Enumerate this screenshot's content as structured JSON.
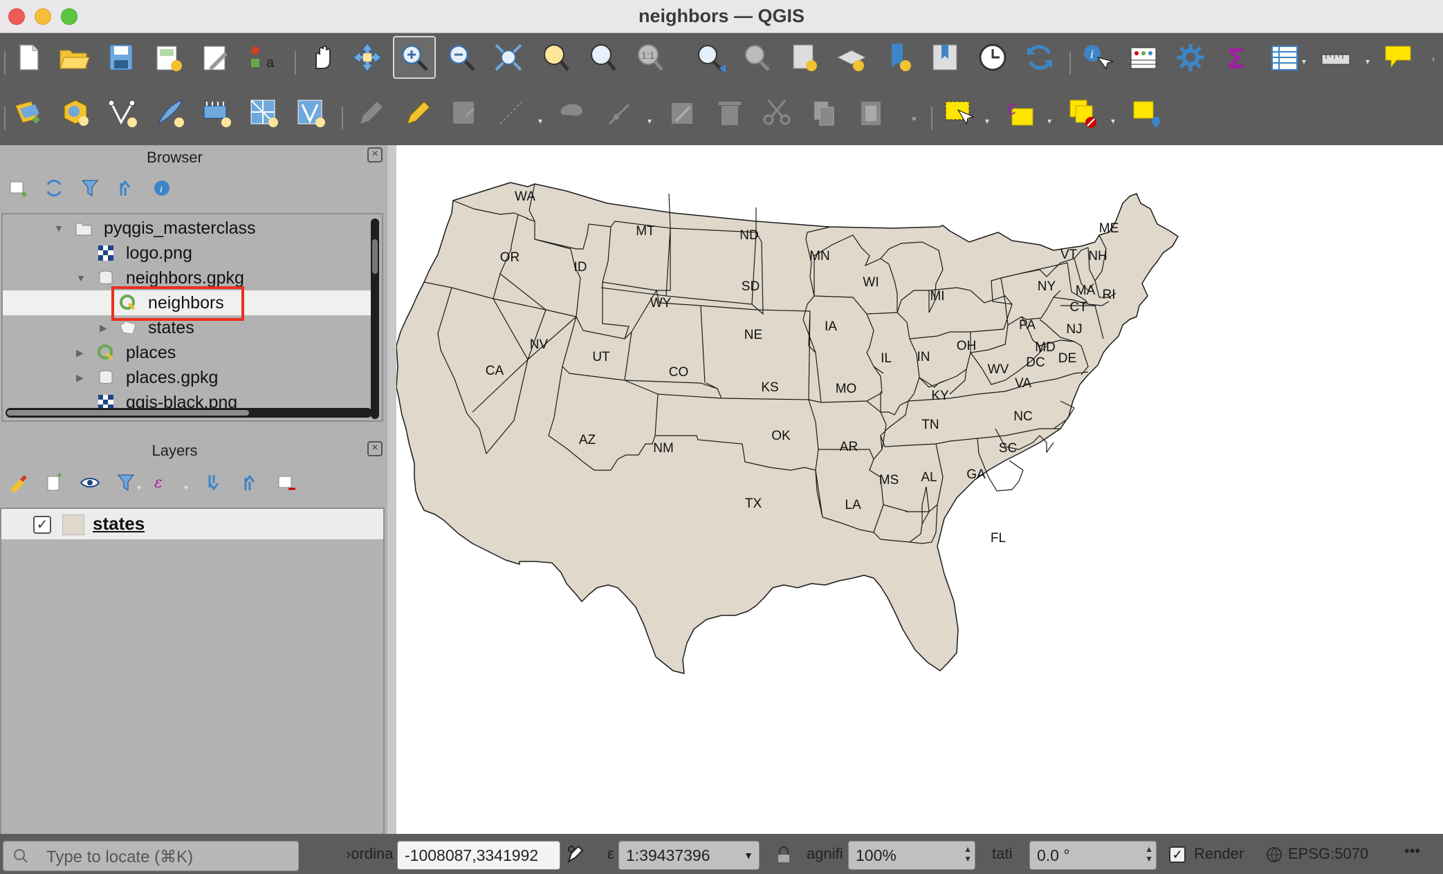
{
  "window": {
    "title": "neighbors — QGIS"
  },
  "browser": {
    "title": "Browser",
    "items": [
      {
        "label": "pyqgis_masterclass",
        "icon": "folder-icon"
      },
      {
        "label": "logo.png",
        "icon": "raster-icon"
      },
      {
        "label": "neighbors.gpkg",
        "icon": "geopackage-icon"
      },
      {
        "label": "neighbors",
        "icon": "qgis-project-icon"
      },
      {
        "label": "states",
        "icon": "polygon-layer-icon"
      },
      {
        "label": "places",
        "icon": "qgis-project-icon"
      },
      {
        "label": "places.gpkg",
        "icon": "geopackage-icon"
      },
      {
        "label": "qgis-black.png",
        "icon": "raster-icon"
      }
    ]
  },
  "layers": {
    "title": "Layers",
    "items": [
      {
        "label": "states",
        "checked": true,
        "swatch_color": "#dfd8cb"
      }
    ]
  },
  "map": {
    "fill_color": "#dfd8cb",
    "labels": [
      "WA",
      "MT",
      "ND",
      "MN",
      "ME",
      "OR",
      "ID",
      "SD",
      "WI",
      "VT",
      "NH",
      "NY",
      "MI",
      "MA",
      "RI",
      "CT",
      "WY",
      "IA",
      "PA",
      "NJ",
      "NE",
      "NV",
      "UT",
      "IL",
      "IN",
      "OH",
      "MD",
      "DE",
      "WV",
      "DC",
      "CA",
      "CO",
      "KS",
      "MO",
      "KY",
      "VA",
      "NC",
      "TN",
      "OK",
      "AR",
      "SC",
      "AZ",
      "NM",
      "MS",
      "AL",
      "GA",
      "TX",
      "LA",
      "FL"
    ]
  },
  "status": {
    "locate_placeholder": "Type to locate (⌘K)",
    "coordinate_label": "›ordina",
    "coordinate_value": "-1008087,3341992",
    "scale_label": "ε",
    "scale_value": "1:39437396",
    "magnifier_label": "agnifi",
    "magnifier_value": "100%",
    "rotation_label": "tati",
    "rotation_value": "0.0 °",
    "render_label": "Render",
    "crs_label": "EPSG:5070",
    "more_label": "•••"
  }
}
